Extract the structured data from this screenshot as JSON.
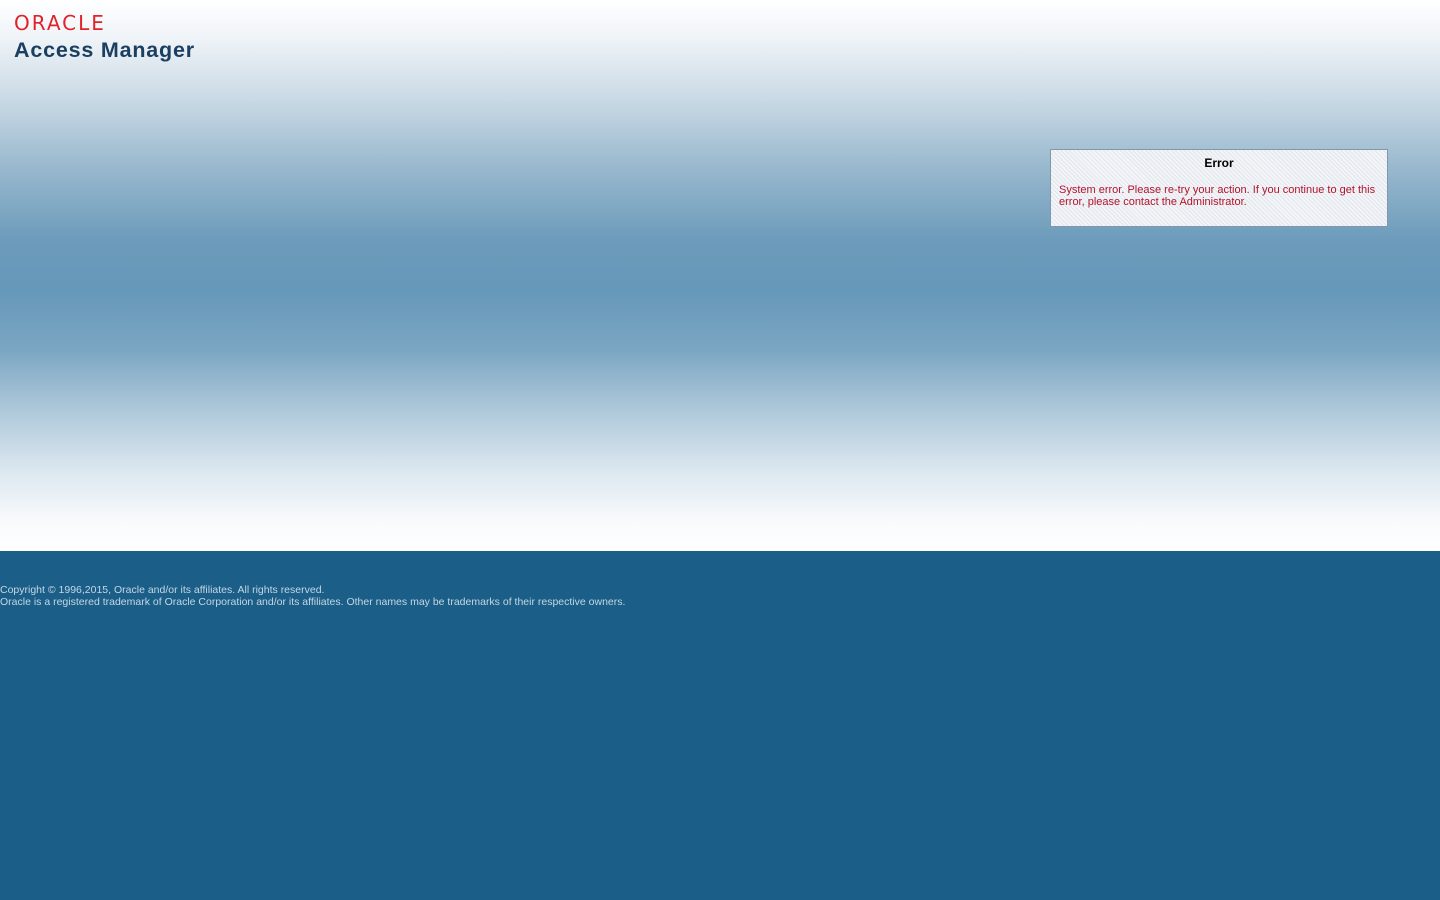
{
  "header": {
    "brand": "ORACLE",
    "product": "Access Manager"
  },
  "error_panel": {
    "title": "Error",
    "message": "System error. Please re-try your action. If you continue to get this error, please contact the Administrator."
  },
  "footer": {
    "copyright": "Copyright © 1996,2015, Oracle and/or its affiliates. All rights reserved.",
    "trademark": "Oracle is a registered trademark of Oracle Corporation and/or its affiliates. Other names may be trademarks of their respective owners."
  },
  "colors": {
    "brand_red": "#e2222a",
    "product_navy": "#1b3f60",
    "error_red": "#b3142c",
    "footer_background": "#1b5f89"
  }
}
